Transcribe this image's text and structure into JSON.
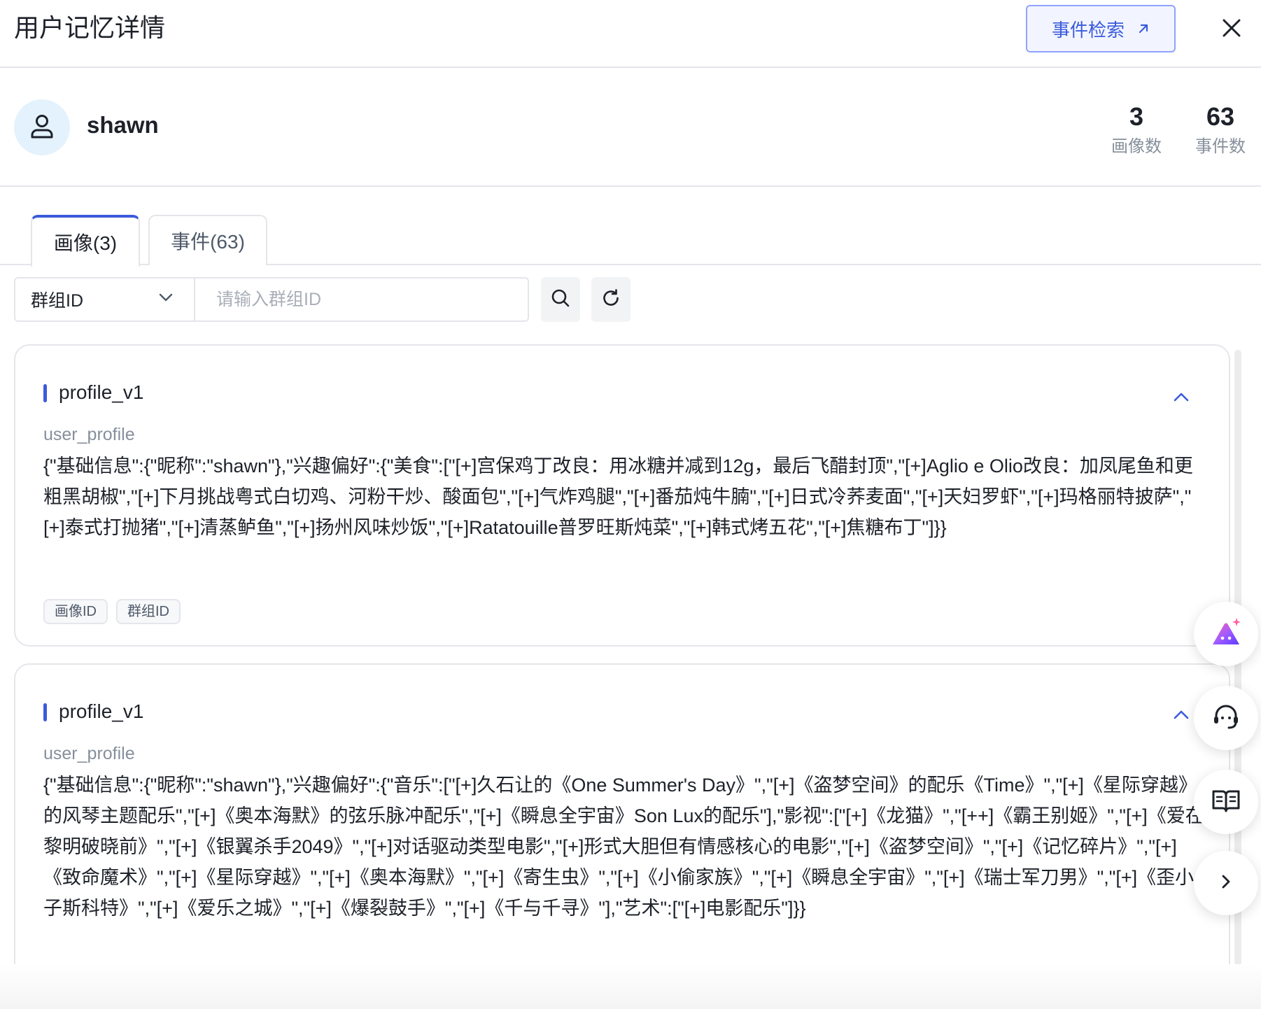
{
  "header": {
    "title": "用户记忆详情",
    "event_search_label": "事件检索",
    "event_search_icon": "arrow-up-right-icon",
    "close_icon": "close-icon"
  },
  "user": {
    "avatar_icon": "user-icon",
    "name": "shawn",
    "stats": [
      {
        "value": "3",
        "label": "画像数"
      },
      {
        "value": "63",
        "label": "事件数"
      }
    ]
  },
  "tabs": [
    {
      "label": "画像(3)",
      "active": true
    },
    {
      "label": "事件(63)",
      "active": false
    }
  ],
  "filter": {
    "select_value": "群组ID",
    "input_placeholder": "请输入群组ID",
    "search_icon": "search-icon",
    "refresh_icon": "refresh-icon"
  },
  "cards": [
    {
      "title": "profile_v1",
      "subtitle": "user_profile",
      "content": "{\"基础信息\":{\"昵称\":\"shawn\"},\"兴趣偏好\":{\"美食\":[\"[+]宫保鸡丁改良：用冰糖并减到12g，最后飞醋封顶\",\"[+]Aglio e Olio改良：加凤尾鱼和更粗黑胡椒\",\"[+]下月挑战粤式白切鸡、河粉干炒、酸面包\",\"[+]气炸鸡腿\",\"[+]番茄炖牛腩\",\"[+]日式冷荞麦面\",\"[+]天妇罗虾\",\"[+]玛格丽特披萨\",\"[+]泰式打抛猪\",\"[+]清蒸鲈鱼\",\"[+]扬州风味炒饭\",\"[+]Ratatouille普罗旺斯炖菜\",\"[+]韩式烤五花\",\"[+]焦糖布丁\"]}}",
      "tags": [
        "画像ID",
        "群组ID"
      ]
    },
    {
      "title": "profile_v1",
      "subtitle": "user_profile",
      "content": "{\"基础信息\":{\"昵称\":\"shawn\"},\"兴趣偏好\":{\"音乐\":[\"[+]久石让的《One Summer's Day》\",\"[+]《盗梦空间》的配乐《Time》\",\"[+]《星际穿越》的风琴主题配乐\",\"[+]《奥本海默》的弦乐脉冲配乐\",\"[+]《瞬息全宇宙》Son Lux的配乐\"],\"影视\":[\"[+]《龙猫》\",\"[++]《霸王别姬》\",\"[+]《爱在黎明破晓前》\",\"[+]《银翼杀手2049》\",\"[+]对话驱动类型电影\",\"[+]形式大胆但有情感核心的电影\",\"[+]《盗梦空间》\",\"[+]《记忆碎片》\",\"[+]《致命魔术》\",\"[+]《星际穿越》\",\"[+]《奥本海默》\",\"[+]《寄生虫》\",\"[+]《小偷家族》\",\"[+]《瞬息全宇宙》\",\"[+]《瑞士军刀男》\",\"[+]《歪小子斯科特》\",\"[+]《爱乐之城》\",\"[+]《爆裂鼓手》\",\"[+]《千与千寻》\"],\"艺术\":[\"[+]电影配乐\"]}}"
    }
  ],
  "floating": {
    "ai_icon": "ai-assistant-icon",
    "support_icon": "headset-icon",
    "docs_icon": "open-book-icon",
    "expand_icon": "chevron-right-icon"
  }
}
